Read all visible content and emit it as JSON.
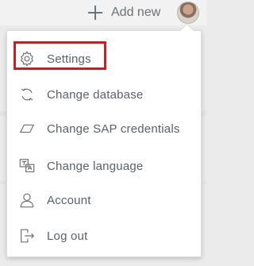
{
  "topbar": {
    "add_new_label": "Add new",
    "add_icon": "plus-icon",
    "avatar_icon": "user-avatar"
  },
  "menu": {
    "items": [
      {
        "label": "Settings",
        "icon": "gear-icon"
      },
      {
        "label": "Change database",
        "icon": "refresh-icon"
      },
      {
        "label": "Change SAP credentials",
        "icon": "parallelogram-icon"
      },
      {
        "label": "Change language",
        "icon": "translate-icon"
      },
      {
        "label": "Account",
        "icon": "user-icon"
      },
      {
        "label": "Log out",
        "icon": "logout-icon"
      }
    ],
    "highlight_color": "#d11b23"
  },
  "colors": {
    "text": "#5a6168",
    "icon": "#6b7278",
    "background": "#ebebeb"
  }
}
